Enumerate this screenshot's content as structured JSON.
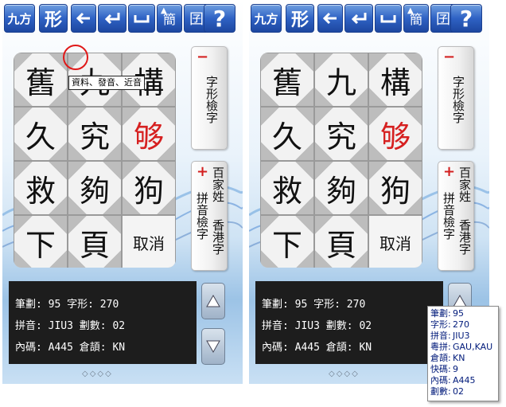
{
  "toolbar": {
    "jiufang_label": "九方",
    "xing_label": "形",
    "jian_label": "簡",
    "tou_label": "囝",
    "help_label": "?"
  },
  "grid": {
    "cells": [
      "舊",
      "九",
      "構",
      "久",
      "究",
      "够",
      "救",
      "夠",
      "狗",
      "下",
      "頁"
    ],
    "cancel_label": "取消"
  },
  "side": {
    "top_sym": "−",
    "top_label": "字形檢字",
    "bottom_sym": "+",
    "bottom_col1": "百家姓",
    "bottom_col2": "香港字",
    "bottom_col3": "拼音檢字"
  },
  "info": {
    "line1": "筆劃: 95 字形: 270",
    "line2": "拼音: JIU3 劃數: 02",
    "line3": "內碼: A445 倉頡: KN"
  },
  "tooltip": {
    "text": "資料、發音、近音"
  },
  "popup": {
    "rows": [
      {
        "k": "筆劃:",
        "v": "95"
      },
      {
        "k": "字形:",
        "v": "270"
      },
      {
        "k": "拼音:",
        "v": "JIU3"
      },
      {
        "k": "粵拼:",
        "v": "GAU,KAU"
      },
      {
        "k": "倉頡:",
        "v": "KN"
      },
      {
        "k": "快碼:",
        "v": "9"
      },
      {
        "k": "內碼:",
        "v": "A445"
      },
      {
        "k": "劃數:",
        "v": "02"
      }
    ]
  },
  "colors": {
    "toolbar_blue": "#2f62c4",
    "accent_red": "#d62020"
  },
  "icons": [
    "back-arrow-icon",
    "enter-icon",
    "space-icon",
    "scroll-up-icon",
    "scroll-down-icon"
  ]
}
